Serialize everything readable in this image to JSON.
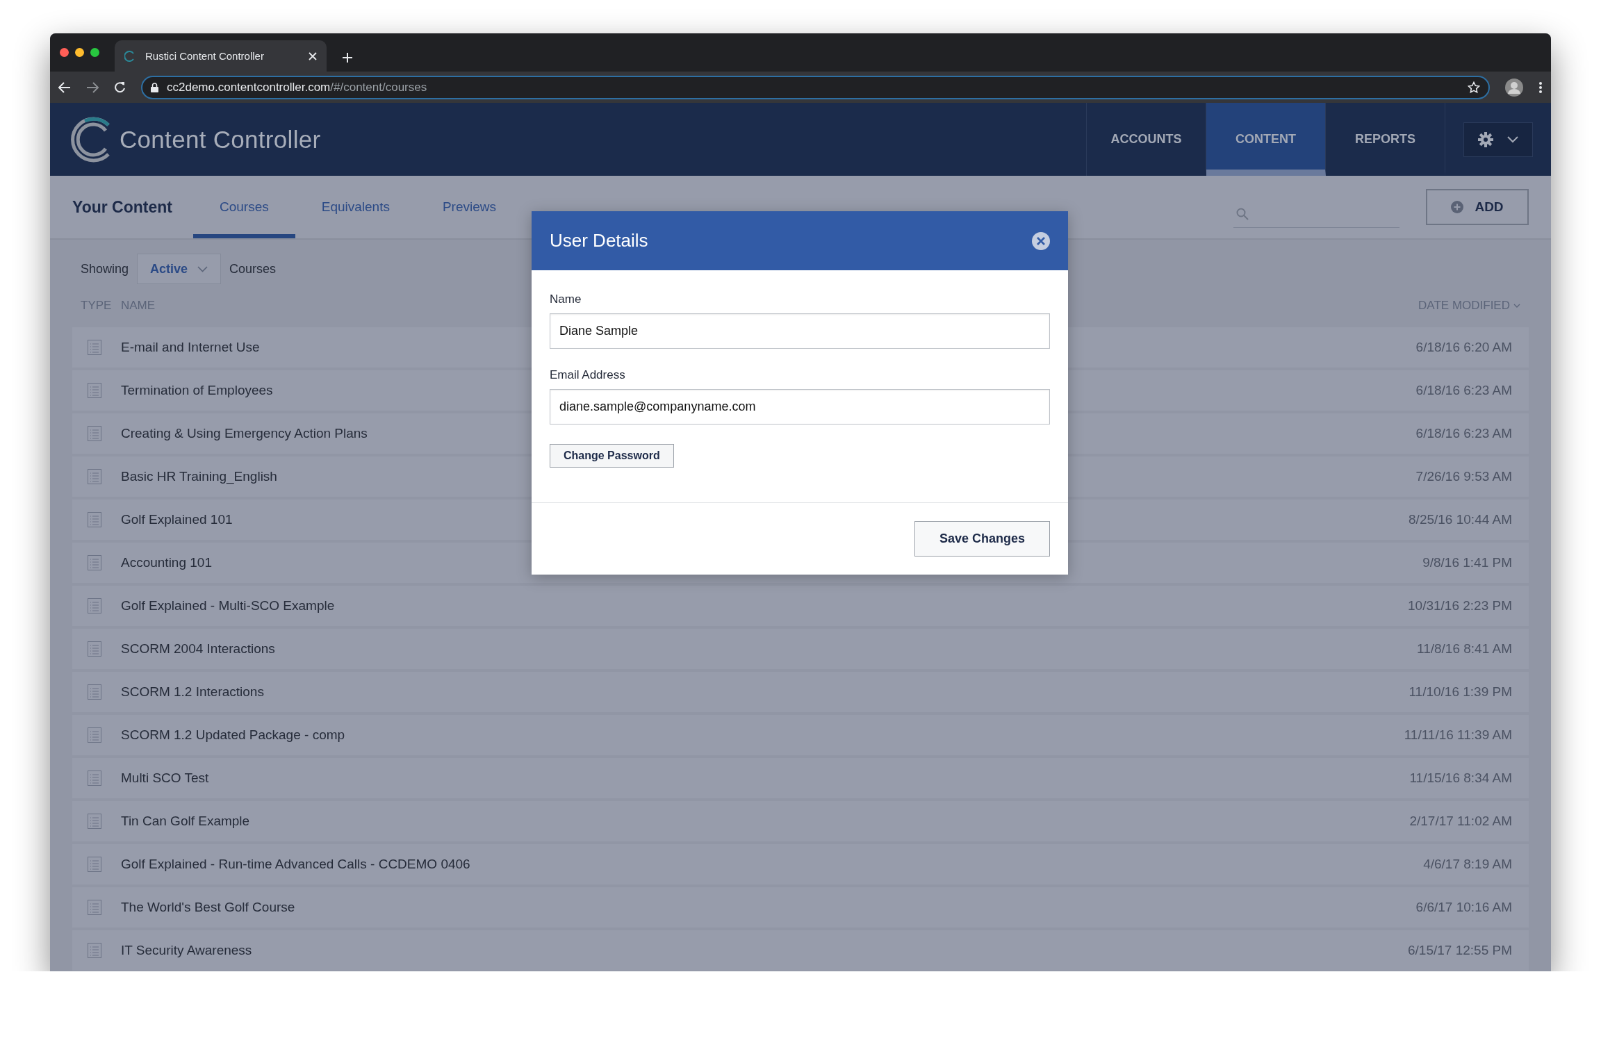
{
  "browser": {
    "tab_title": "Rustici Content Controller",
    "url_host": "cc2demo.contentcontroller.com",
    "url_path": "/#/content/courses"
  },
  "header": {
    "logo_text": "Content Controller",
    "nav": [
      {
        "label": "ACCOUNTS",
        "selected": false
      },
      {
        "label": "CONTENT",
        "selected": true
      },
      {
        "label": "REPORTS",
        "selected": false
      }
    ]
  },
  "subnav": {
    "title": "Your Content",
    "tabs": [
      {
        "label": "Courses",
        "selected": true
      },
      {
        "label": "Equivalents",
        "selected": false
      },
      {
        "label": "Previews",
        "selected": false
      }
    ],
    "add_button": "ADD"
  },
  "filter": {
    "prefix": "Showing",
    "value": "Active",
    "suffix": "Courses"
  },
  "table": {
    "columns": [
      "TYPE",
      "NAME",
      "DATE MODIFIED"
    ],
    "rows": [
      {
        "name": "E-mail and Internet Use",
        "date": "6/18/16 6:20 AM"
      },
      {
        "name": "Termination of Employees",
        "date": "6/18/16 6:23 AM"
      },
      {
        "name": "Creating & Using Emergency Action Plans",
        "date": "6/18/16 6:23 AM"
      },
      {
        "name": "Basic HR Training_English",
        "date": "7/26/16 9:53 AM"
      },
      {
        "name": "Golf Explained 101",
        "date": "8/25/16 10:44 AM"
      },
      {
        "name": "Accounting 101",
        "date": "9/8/16 1:41 PM"
      },
      {
        "name": "Golf Explained - Multi-SCO Example",
        "date": "10/31/16 2:23 PM"
      },
      {
        "name": "SCORM 2004 Interactions",
        "date": "11/8/16 8:41 AM"
      },
      {
        "name": "SCORM 1.2 Interactions",
        "date": "11/10/16 1:39 PM"
      },
      {
        "name": "SCORM 1.2 Updated Package - comp",
        "date": "11/11/16 11:39 AM"
      },
      {
        "name": "Multi SCO Test",
        "date": "11/15/16 8:34 AM"
      },
      {
        "name": "Tin Can Golf Example",
        "date": "2/17/17 11:02 AM"
      },
      {
        "name": "Golf Explained - Run-time Advanced Calls - CCDEMO 0406",
        "date": "4/6/17 8:19 AM"
      },
      {
        "name": "The World's Best Golf Course",
        "date": "6/6/17 10:16 AM"
      },
      {
        "name": "IT Security Awareness",
        "date": "6/15/17 12:55 PM"
      }
    ]
  },
  "modal": {
    "title": "User Details",
    "fields": [
      {
        "label": "Name",
        "value": "Diane Sample"
      },
      {
        "label": "Email Address",
        "value": "diane.sample@companyname.com"
      }
    ],
    "change_password": "Change Password",
    "save": "Save Changes"
  }
}
